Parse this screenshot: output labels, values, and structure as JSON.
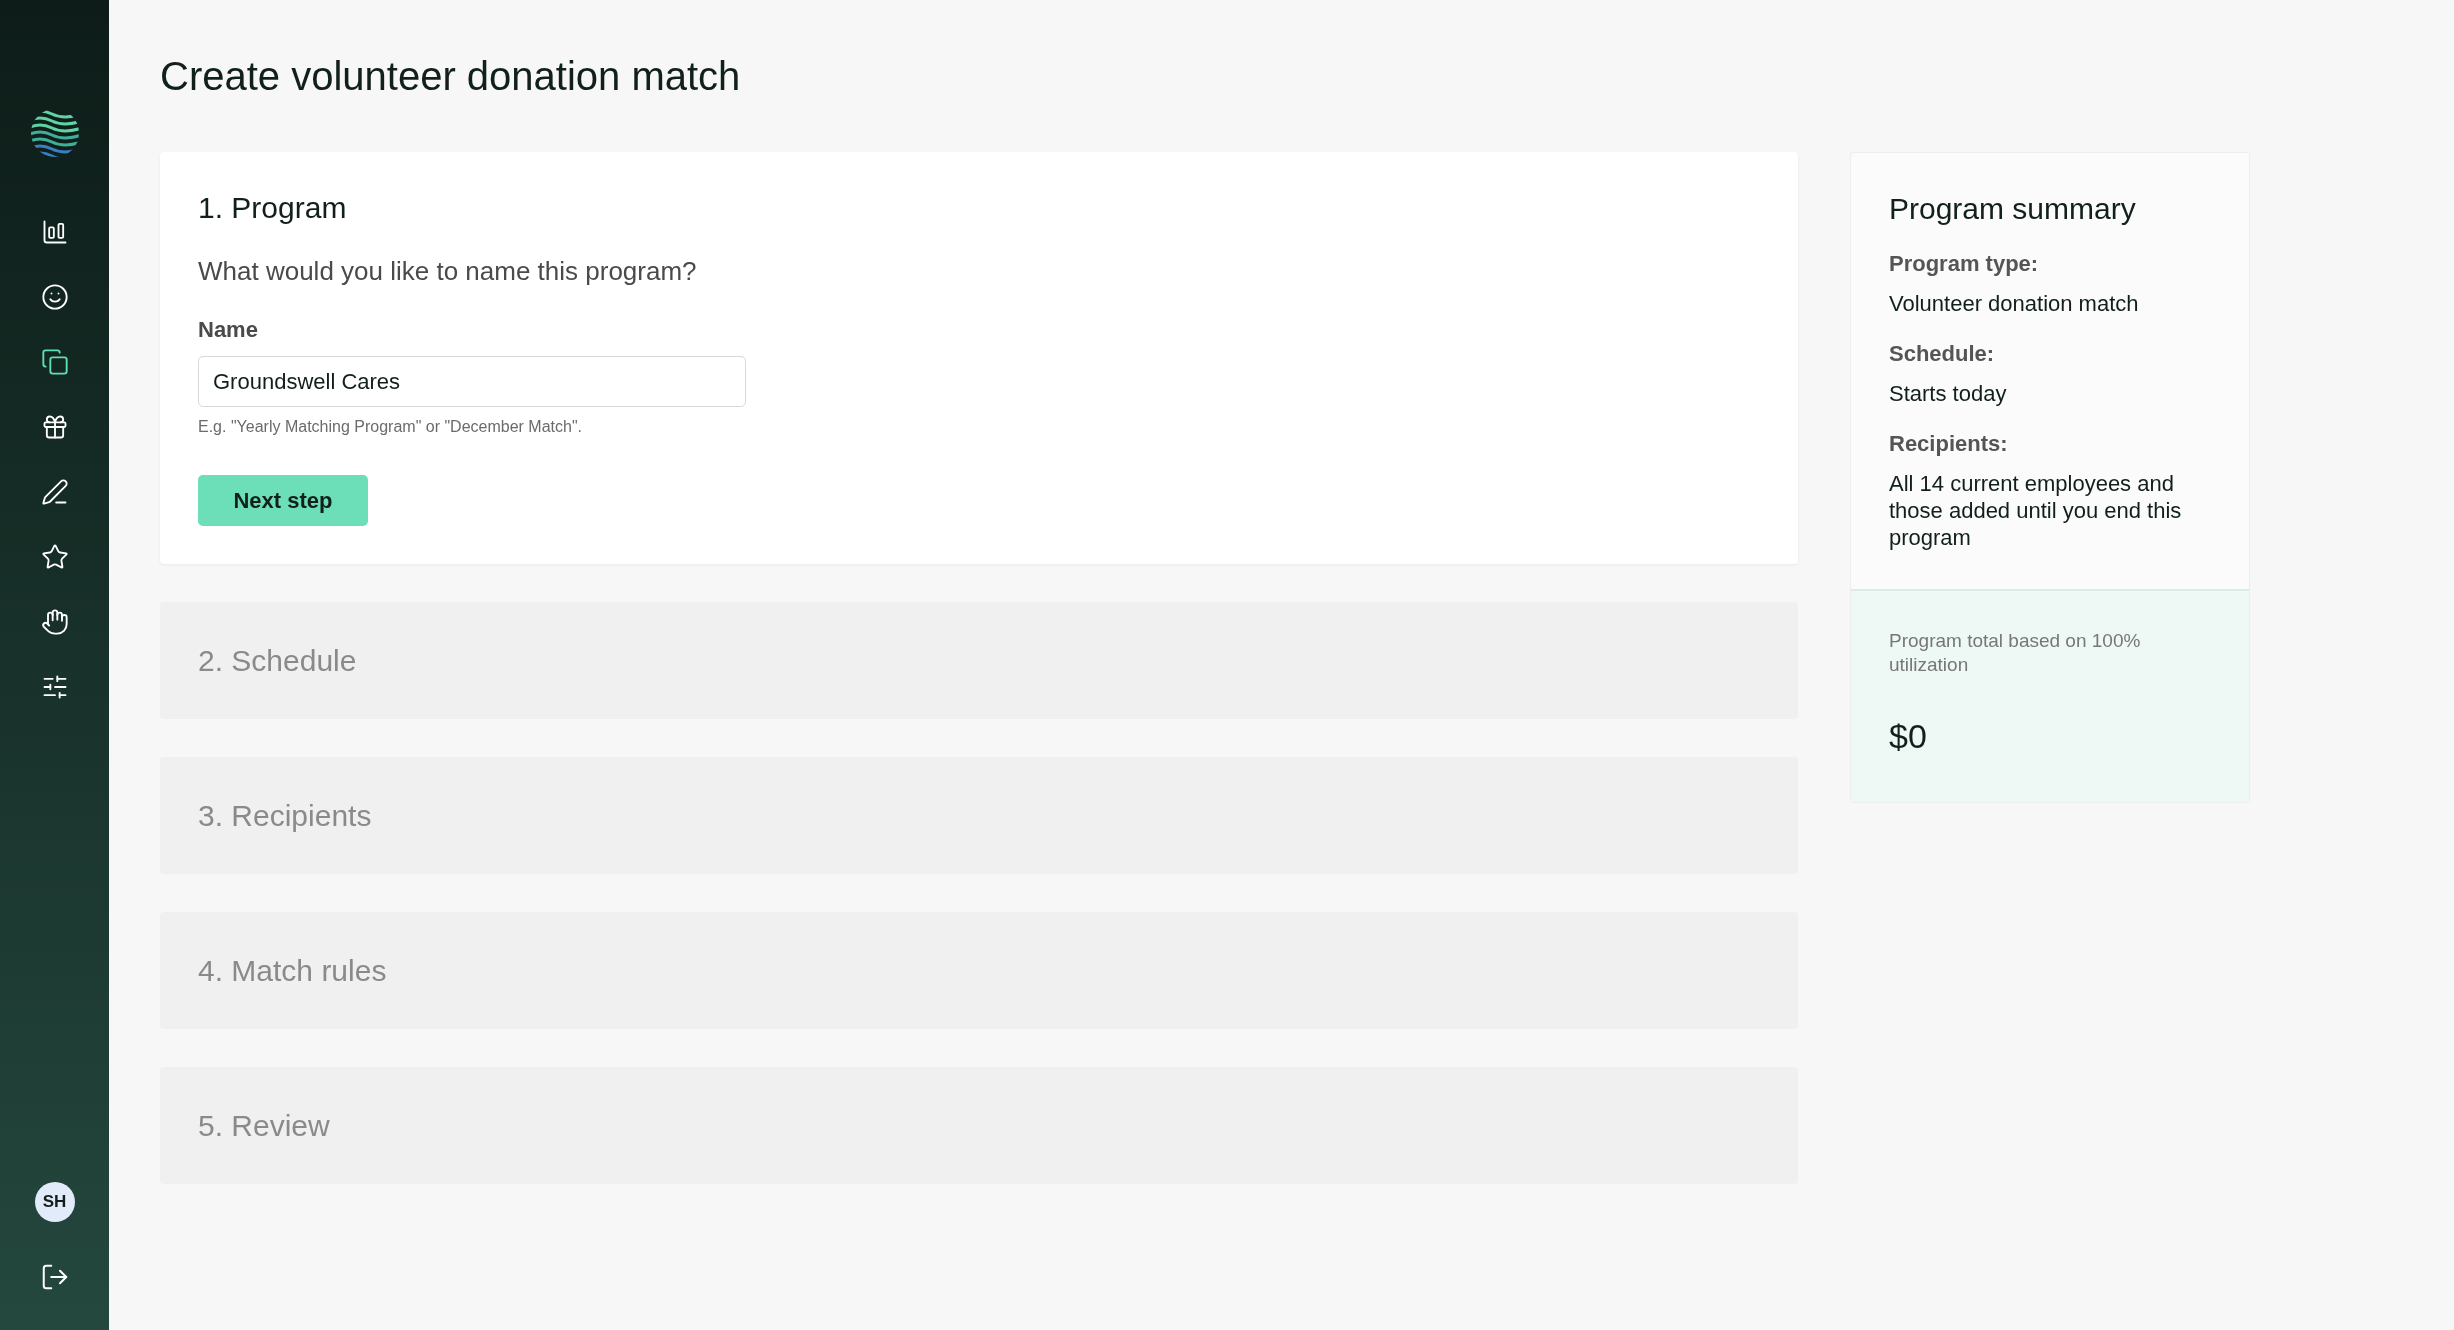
{
  "sidebar": {
    "nav_items": [
      {
        "selected": false
      },
      {
        "selected": false
      },
      {
        "selected": true
      },
      {
        "selected": false
      },
      {
        "selected": false
      },
      {
        "selected": false
      },
      {
        "selected": false
      },
      {
        "selected": false
      }
    ],
    "avatar": "SH"
  },
  "page_title": "Create volunteer donation match",
  "steps": [
    {
      "title": "1. Program",
      "expanded": true,
      "question": "What would you like to name this program?",
      "field_label": "Name",
      "field_value": "Groundswell Cares",
      "hint": "E.g. \"Yearly Matching Program\" or \"December Match\".",
      "button": "Next step"
    },
    {
      "title": "2. Schedule",
      "expanded": false
    },
    {
      "title": "3. Recipients",
      "expanded": false
    },
    {
      "title": "4. Match rules",
      "expanded": false
    },
    {
      "title": "5. Review",
      "expanded": false
    }
  ],
  "summary": {
    "title": "Program summary",
    "items": [
      {
        "label": "Program type:",
        "value": "Volunteer donation match"
      },
      {
        "label": "Schedule:",
        "value": "Starts today"
      },
      {
        "label": "Recipients:",
        "value": "All 14 current employees and those added until you end this program"
      }
    ],
    "total_label": "Program total based on 100% utilization",
    "total": "$0"
  }
}
